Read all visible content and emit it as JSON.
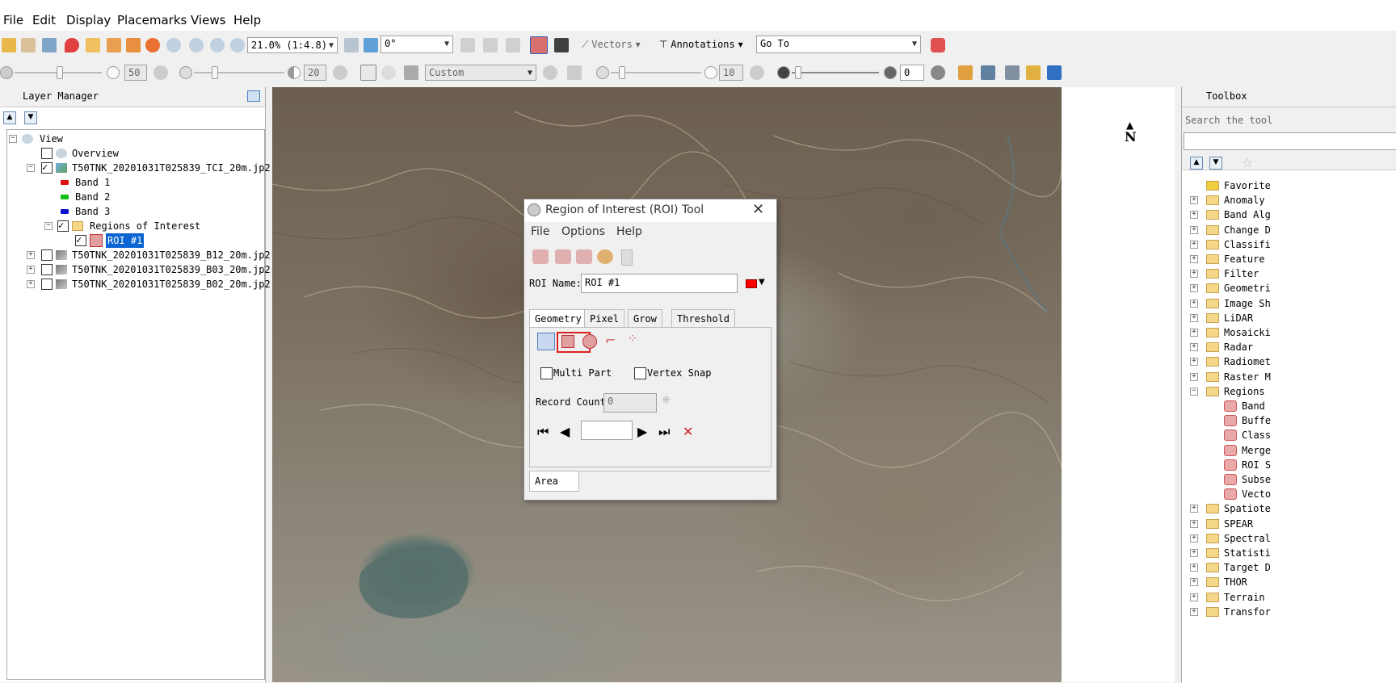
{
  "menubar": {
    "items": [
      "File",
      "Edit",
      "Display",
      "Placemarks",
      "Views",
      "Help"
    ]
  },
  "toolbar1": {
    "zoom_value": "21.0% (1:4.8)",
    "rotation_value": "0°",
    "vectors_label": "Vectors",
    "annotations_label": "Annotations",
    "goto_value": "Go To"
  },
  "toolbar2": {
    "brightness_value": "50",
    "contrast_value": "20",
    "stretch_value": "Custom",
    "sharpen_value": "10",
    "transparency_value": "0"
  },
  "layer_manager": {
    "title": "Layer Manager",
    "items": [
      {
        "label": "View"
      },
      {
        "label": "Overview"
      },
      {
        "label": "T50TNK_20201031T025839_TCI_20m.jp2"
      },
      {
        "label": "Band 1",
        "color": "#e01010"
      },
      {
        "label": "Band 2",
        "color": "#10c010"
      },
      {
        "label": "Band 3",
        "color": "#1010d0"
      },
      {
        "label": "Regions of Interest"
      },
      {
        "label": "ROI #1"
      },
      {
        "label": "T50TNK_20201031T025839_B12_20m.jp2"
      },
      {
        "label": "T50TNK_20201031T025839_B03_20m.jp2"
      },
      {
        "label": "T50TNK_20201031T025839_B02_20m.jp2"
      }
    ]
  },
  "compass": {
    "label": "N"
  },
  "toolbox": {
    "title": "Toolbox",
    "search_placeholder": "Search the tool",
    "items": [
      "Favorite",
      "Anomaly",
      "Band Alg",
      "Change D",
      "Classifi",
      "Feature",
      "Filter",
      "Geometri",
      "Image Sh",
      "LiDAR",
      "Mosaicki",
      "Radar",
      "Radiomet",
      "Raster M",
      "Regions"
    ],
    "sub_items": [
      "Band",
      "Buffe",
      "Class",
      "Merge",
      "ROI S",
      "Subse",
      "Vecto"
    ],
    "items_after": [
      "Spatiote",
      "SPEAR",
      "Spectral",
      "Statisti",
      "Target D",
      "THOR",
      "Terrain",
      "Transfor"
    ]
  },
  "roi_dialog": {
    "title": "Region of Interest (ROI) Tool",
    "menu": [
      "File",
      "Options",
      "Help"
    ],
    "roi_name_label": "ROI Name:",
    "roi_name_value": "ROI #1",
    "roi_color": "#ff0000",
    "tabs": [
      "Geometry",
      "Pixel",
      "Grow",
      "Threshold"
    ],
    "multi_part_label": "Multi Part",
    "vertex_snap_label": "Vertex Snap",
    "record_count_label": "Record Count",
    "record_count_value": "0",
    "bottom_tab": "Area",
    "highlight_color": "#e02020"
  }
}
